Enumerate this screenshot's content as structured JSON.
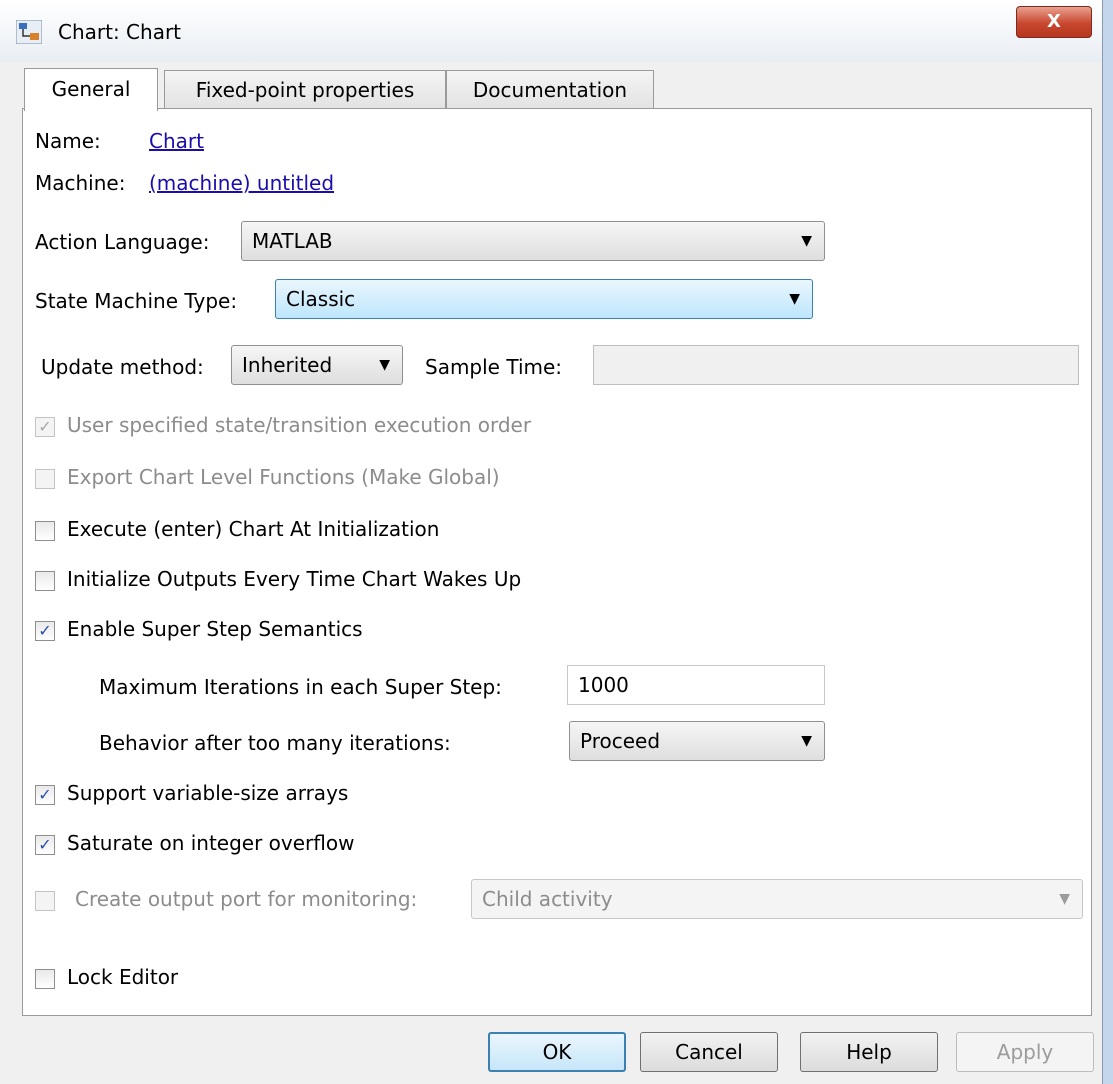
{
  "window": {
    "title": "Chart: Chart",
    "close_label": "X"
  },
  "tabs": [
    {
      "label": "General",
      "active": true
    },
    {
      "label": "Fixed-point properties",
      "active": false
    },
    {
      "label": "Documentation",
      "active": false
    }
  ],
  "general": {
    "name_label": "Name:",
    "name_value": "Chart",
    "machine_label": "Machine:",
    "machine_value": "(machine) untitled",
    "action_language_label": "Action Language:",
    "action_language_value": "MATLAB",
    "state_machine_type_label": "State Machine Type:",
    "state_machine_type_value": "Classic",
    "update_method_label": "Update method:",
    "update_method_value": "Inherited",
    "sample_time_label": "Sample Time:",
    "sample_time_value": ""
  },
  "checkboxes": {
    "user_order": {
      "label": "User specified state/transition execution order",
      "checked": true,
      "enabled": false
    },
    "export_functions": {
      "label": "Export Chart Level Functions (Make Global)",
      "checked": false,
      "enabled": false
    },
    "execute_at_init": {
      "label": "Execute (enter) Chart At Initialization",
      "checked": false,
      "enabled": true
    },
    "init_outputs": {
      "label": "Initialize Outputs Every Time Chart Wakes Up",
      "checked": false,
      "enabled": true
    },
    "super_step": {
      "label": "Enable Super Step Semantics",
      "checked": true,
      "enabled": true
    },
    "variable_size": {
      "label": "Support variable-size arrays",
      "checked": true,
      "enabled": true
    },
    "saturate": {
      "label": "Saturate on integer overflow",
      "checked": true,
      "enabled": true
    },
    "output_port": {
      "label": "Create output port for monitoring:",
      "checked": false,
      "enabled": false
    },
    "lock_editor": {
      "label": "Lock Editor",
      "checked": false,
      "enabled": true
    }
  },
  "super_step": {
    "max_iterations_label": "Maximum Iterations in each Super Step:",
    "max_iterations_value": "1000",
    "behavior_label": "Behavior after too many iterations:",
    "behavior_value": "Proceed"
  },
  "monitoring": {
    "value": "Child activity"
  },
  "buttons": {
    "ok": "OK",
    "cancel": "Cancel",
    "help": "Help",
    "apply": "Apply"
  },
  "colors": {
    "link": "#1a0dab",
    "checkmark": "#2b4fa8",
    "close_button": "#c8472f",
    "focus_border": "#3c7fb1"
  }
}
